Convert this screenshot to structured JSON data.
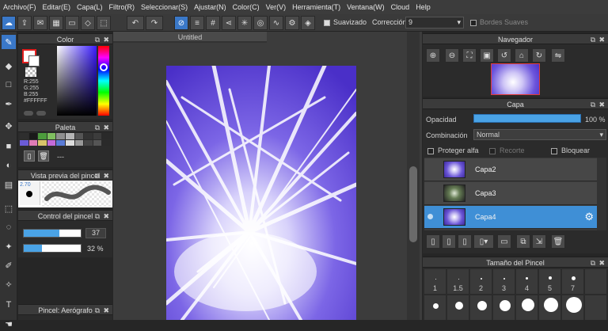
{
  "menu": [
    "Archivo(F)",
    "Editar(E)",
    "Capa(L)",
    "Filtro(R)",
    "Seleccionar(S)",
    "Ajustar(N)",
    "Color(C)",
    "Ver(V)",
    "Herramienta(T)",
    "Ventana(W)",
    "Cloud",
    "Help"
  ],
  "toolbar": {
    "smoothing_label": "Suavizado",
    "correction_label": "Corrección",
    "correction_value": "9",
    "soft_edges_label": "Bordes Suaves"
  },
  "color_panel": {
    "title": "Color",
    "r": "R:255",
    "g": "G:255",
    "b": "B:255",
    "hex": "#FFFFFF"
  },
  "palette_panel": {
    "title": "Paleta",
    "value": "---"
  },
  "brush_preview": {
    "title": "Vista previa del pincel",
    "size": "2.70"
  },
  "brush_control": {
    "title": "Control del pincel",
    "size_value": "37",
    "opacity_value": "32 %"
  },
  "brush_name": {
    "title": "Pincel: Aerógrafo"
  },
  "canvas": {
    "tab": "Untitled"
  },
  "navigator": {
    "title": "Navegador"
  },
  "layer_panel": {
    "title": "Capa",
    "opacity_label": "Opacidad",
    "opacity_value": "100 %",
    "blend_label": "Combinación",
    "blend_value": "Normal",
    "protect_alpha": "Proteger alfa",
    "clip": "Recorte",
    "lock": "Bloquear",
    "layers": [
      {
        "name": "Capa2"
      },
      {
        "name": "Capa3"
      },
      {
        "name": "Capa4"
      }
    ]
  },
  "brush_size_panel": {
    "title": "Tamaño del Pincel",
    "sizes": [
      "1",
      "1.5",
      "2",
      "3",
      "4",
      "5",
      "7"
    ]
  },
  "colors": {
    "accent": "#3f8fd6",
    "bg": "#262626"
  }
}
